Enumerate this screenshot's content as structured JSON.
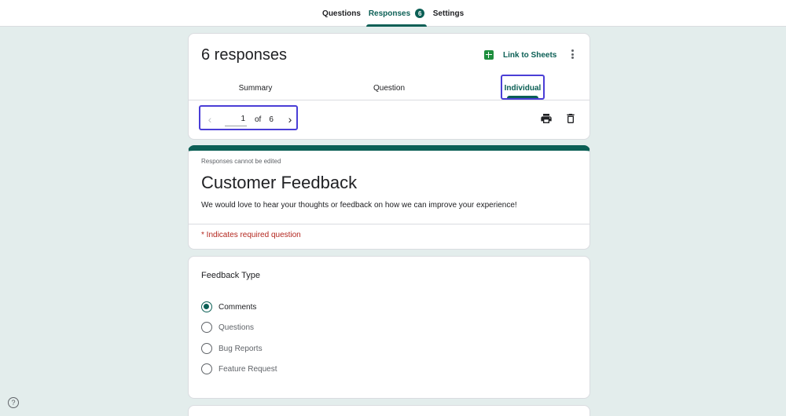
{
  "top_tabs": {
    "questions": "Questions",
    "responses": "Responses",
    "responses_count": "6",
    "settings": "Settings"
  },
  "summary": {
    "title": "6 responses",
    "link_to_sheets": "Link to Sheets",
    "tabs": {
      "summary": "Summary",
      "question": "Question",
      "individual": "Individual"
    },
    "pager": {
      "current": "1",
      "of": "of",
      "total": "6"
    }
  },
  "form": {
    "notice": "Responses cannot be edited",
    "title": "Customer Feedback",
    "description": "We would love to hear your thoughts or feedback on how we can improve your experience!",
    "required_note": "* Indicates required question"
  },
  "question": {
    "title": "Feedback Type",
    "options": [
      {
        "label": "Comments",
        "selected": true
      },
      {
        "label": "Questions",
        "selected": false
      },
      {
        "label": "Bug Reports",
        "selected": false
      },
      {
        "label": "Feature Request",
        "selected": false
      }
    ]
  },
  "help_label": "?",
  "icons": [
    "sheets-icon",
    "more-vert-icon",
    "chevron-left-icon",
    "chevron-right-icon",
    "print-icon",
    "delete-icon",
    "help-icon"
  ],
  "colors": {
    "accent": "#0b5f55",
    "background": "#e3edec",
    "required": "#b3261e",
    "focus": "#4a3ed6"
  }
}
